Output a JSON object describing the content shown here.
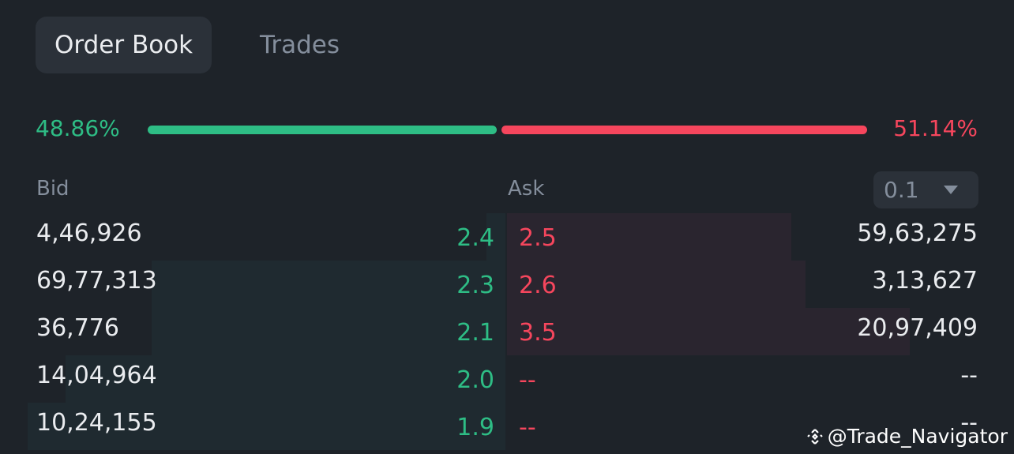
{
  "tabs": [
    {
      "label": "Order Book",
      "active": true
    },
    {
      "label": "Trades",
      "active": false
    }
  ],
  "ratio": {
    "bid_percent_label": "48.86%",
    "ask_percent_label": "51.14%",
    "bid_fraction": 0.4886
  },
  "headers": {
    "bid": "Bid",
    "ask": "Ask"
  },
  "precision_select": {
    "value": "0.1"
  },
  "colors": {
    "bid": "#2ebd85",
    "ask": "#f6465d",
    "text": "#eaecef",
    "muted": "#848e9c",
    "bg": "#1e2329"
  },
  "rows": [
    {
      "bid_qty": "4,46,926",
      "bid_price": "2.4",
      "ask_price": "2.5",
      "ask_qty": "59,63,275",
      "bid_depth": 0.04,
      "ask_depth": 0.6
    },
    {
      "bid_qty": "69,77,313",
      "bid_price": "2.3",
      "ask_price": "2.6",
      "ask_qty": "3,13,627",
      "bid_depth": 0.74,
      "ask_depth": 0.63
    },
    {
      "bid_qty": "36,776",
      "bid_price": "2.1",
      "ask_price": "3.5",
      "ask_qty": "20,97,409",
      "bid_depth": 0.74,
      "ask_depth": 0.85
    },
    {
      "bid_qty": "14,04,964",
      "bid_price": "2.0",
      "ask_price": "--",
      "ask_qty": "--",
      "bid_depth": 0.92,
      "ask_depth": 0
    },
    {
      "bid_qty": "10,24,155",
      "bid_price": "1.9",
      "ask_price": "--",
      "ask_qty": "--",
      "bid_depth": 1.0,
      "ask_depth": 0
    }
  ],
  "watermark": "@Trade_Navigator"
}
